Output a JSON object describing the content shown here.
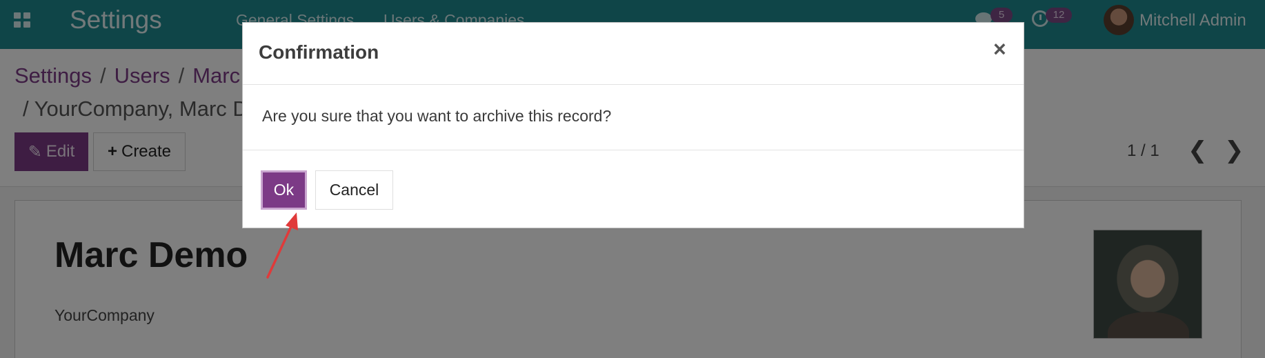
{
  "navbar": {
    "app_title": "Settings",
    "menu": [
      "General Settings",
      "Users & Companies"
    ],
    "messages_count": "5",
    "activities_count": "12",
    "user_name": "Mitchell Admin"
  },
  "breadcrumb": {
    "items": [
      "Settings",
      "Users",
      "Marc"
    ],
    "current": "/ YourCompany, Marc D"
  },
  "toolbar": {
    "edit_label": "Edit",
    "create_label": "Create"
  },
  "pager": {
    "value": "1 / 1",
    "prev": "❮",
    "next": "❯"
  },
  "record": {
    "name": "Marc Demo",
    "company": "YourCompany"
  },
  "dialog": {
    "title": "Confirmation",
    "close_glyph": "×",
    "message": "Are you sure that you want to archive this record?",
    "ok_label": "Ok",
    "cancel_label": "Cancel"
  },
  "colors": {
    "navbar": "#1f8a91",
    "primary": "#7c3a86",
    "annotation_arrow": "#e03a3a"
  }
}
